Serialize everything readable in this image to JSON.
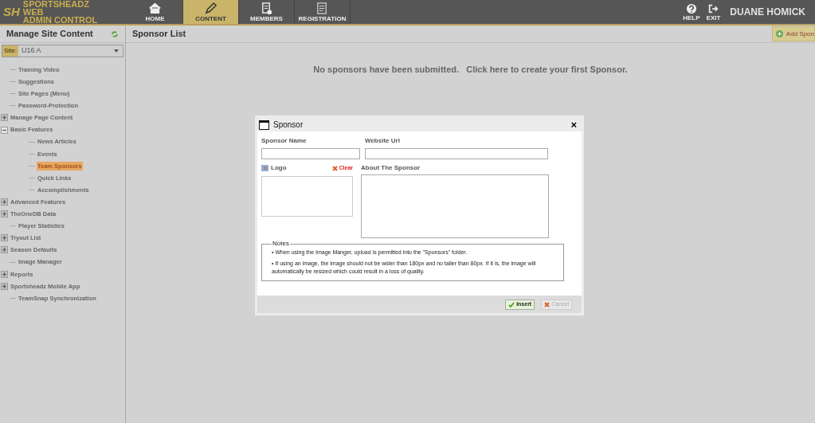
{
  "logo": {
    "mark": "SH",
    "lines": [
      "SPORTSHEADZ",
      "WEB",
      "ADMIN CONTROL"
    ]
  },
  "nav": [
    {
      "label": "HOME",
      "selected": false
    },
    {
      "label": "CONTENT",
      "selected": true
    },
    {
      "label": "MEMBERS",
      "selected": false
    },
    {
      "label": "REGISTRATION",
      "selected": false
    }
  ],
  "header_actions": [
    {
      "label": "HELP"
    },
    {
      "label": "EXIT"
    }
  ],
  "user": "DUANE HOMICK",
  "sidebar": {
    "title": "Manage Site Content",
    "site_label": "Site:",
    "site_value": "U16 A",
    "items": [
      {
        "label": "Training Video",
        "selected": false
      },
      {
        "label": "Suggestions",
        "selected": false
      },
      {
        "label": "Site Pages (Menu)",
        "selected": false
      },
      {
        "label": "Password-Protection",
        "selected": false
      },
      {
        "label": "Manage Page Content",
        "selected": false,
        "expanded": false
      },
      {
        "label": "Basic Features",
        "selected": false,
        "expanded": true,
        "children": [
          {
            "label": "News Articles",
            "selected": false
          },
          {
            "label": "Events",
            "selected": false
          },
          {
            "label": "Team Sponsors",
            "selected": true
          },
          {
            "label": "Quick Links",
            "selected": false
          },
          {
            "label": "Accomplishments",
            "selected": false
          }
        ]
      },
      {
        "label": "Advanced Features",
        "selected": false,
        "expanded": false
      },
      {
        "label": "TheOneDB Data",
        "selected": false,
        "expanded": false
      },
      {
        "label": "Player Statistics",
        "selected": false
      },
      {
        "label": "Tryout List",
        "selected": false,
        "expanded": false
      },
      {
        "label": "Season Defaults",
        "selected": false,
        "expanded": false
      },
      {
        "label": "Image Manager",
        "selected": false
      },
      {
        "label": "Reports",
        "selected": false,
        "expanded": false
      },
      {
        "label": "Sportsheadz Mobile App",
        "selected": false,
        "expanded": false
      },
      {
        "label": "TeamSnap Synchronization",
        "selected": false
      }
    ]
  },
  "main": {
    "title": "Sponsor List",
    "add_button": "Add Spon",
    "empty_message": "No sponsors have been submitted.   Click here to create your first Sponsor."
  },
  "dialog": {
    "title": "Sponsor",
    "close": "×",
    "fields": {
      "name_label": "Sponsor Name",
      "url_label": "Website Url",
      "logo_label": "Logo",
      "clear": "Clear",
      "about_label": "About The Sponsor"
    },
    "notes_title": "Notes",
    "notes": [
      "• When using the Image Manger, upload is permitted into the \"Sponsors\" folder.",
      "• If using an image, the image should not be wider than 180px and no taller than 80px. If it is, the image will automatically be resized which could result in a loss of quality."
    ],
    "buttons": [
      {
        "label": "Insert",
        "disabled": false
      },
      {
        "label": "Cancel",
        "disabled": true
      }
    ]
  }
}
